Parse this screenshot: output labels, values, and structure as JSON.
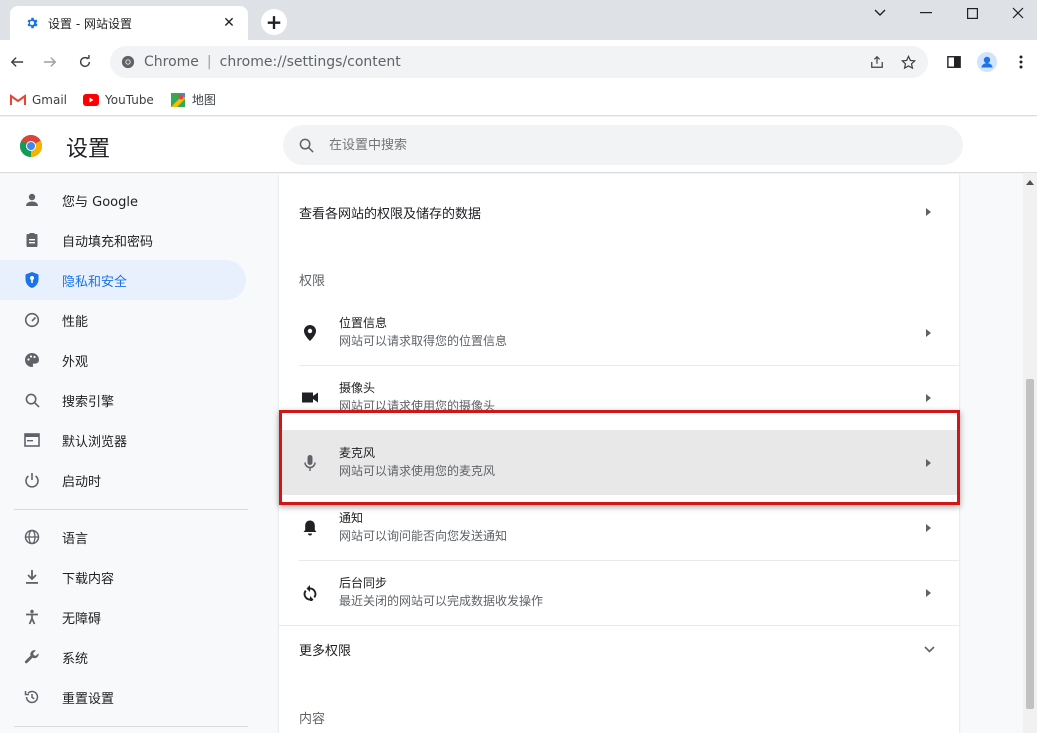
{
  "window": {
    "tab_title": "设置 - 网站设置",
    "tab_close": "✕",
    "new_tab": "+",
    "controls": {
      "dropdown": "⌄",
      "minimize": "—",
      "maximize": "☐",
      "close": "✕"
    }
  },
  "toolbar": {
    "chrome_label": "Chrome",
    "separator": "|",
    "url": "chrome://settings/content"
  },
  "bookmarks": [
    {
      "label": "Gmail",
      "icon": "gmail-icon"
    },
    {
      "label": "YouTube",
      "icon": "youtube-icon"
    },
    {
      "label": "地图",
      "icon": "maps-icon"
    }
  ],
  "settings_header": {
    "title": "设置",
    "search_placeholder": "在设置中搜索"
  },
  "sidebar": {
    "items": [
      {
        "label": "您与 Google",
        "icon": "person-icon"
      },
      {
        "label": "自动填充和密码",
        "icon": "clipboard-icon"
      },
      {
        "label": "隐私和安全",
        "icon": "shield-icon",
        "active": true
      },
      {
        "label": "性能",
        "icon": "speedometer-icon"
      },
      {
        "label": "外观",
        "icon": "palette-icon"
      },
      {
        "label": "搜索引擎",
        "icon": "search-icon"
      },
      {
        "label": "默认浏览器",
        "icon": "browser-icon"
      },
      {
        "label": "启动时",
        "icon": "power-icon"
      },
      {
        "label": "语言",
        "icon": "globe-icon"
      },
      {
        "label": "下载内容",
        "icon": "download-icon"
      },
      {
        "label": "无障碍",
        "icon": "accessibility-icon"
      },
      {
        "label": "系统",
        "icon": "wrench-icon"
      },
      {
        "label": "重置设置",
        "icon": "history-icon"
      }
    ]
  },
  "content": {
    "view_sites_data": "查看各网站的权限及储存的数据",
    "permissions_title": "权限",
    "permissions": [
      {
        "title": "位置信息",
        "subtitle": "网站可以请求取得您的位置信息",
        "icon": "location-icon"
      },
      {
        "title": "摄像头",
        "subtitle": "网站可以请求使用您的摄像头",
        "icon": "camera-icon"
      },
      {
        "title": "麦克风",
        "subtitle": "网站可以请求使用您的麦克风",
        "icon": "microphone-icon",
        "highlighted": true
      },
      {
        "title": "通知",
        "subtitle": "网站可以询问能否向您发送通知",
        "icon": "bell-icon"
      },
      {
        "title": "后台同步",
        "subtitle": "最近关闭的网站可以完成数据收发操作",
        "icon": "sync-icon"
      }
    ],
    "more_permissions": "更多权限",
    "content_title": "内容"
  },
  "colors": {
    "accent": "#1a73e8",
    "highlight_border": "#d01616",
    "active_nav_bg": "#e8f0fe"
  }
}
